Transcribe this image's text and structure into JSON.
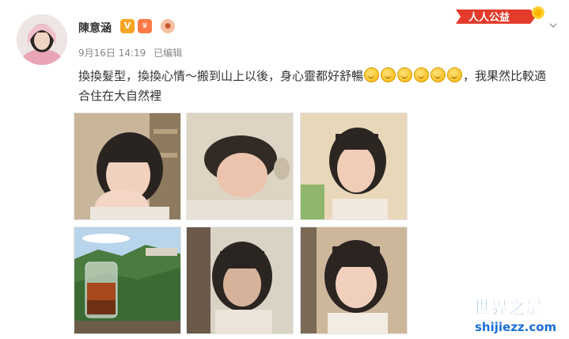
{
  "user": {
    "name": "陳意涵",
    "badges": [
      "verified-v-icon",
      "vip-crown-icon",
      "pig-icon"
    ]
  },
  "meta": {
    "date": "9月16日 14:19",
    "edited": "已编辑"
  },
  "renren": {
    "label": "人人公益"
  },
  "post": {
    "text_part1": "換換髮型，換換心情～搬到山上以後，身心靈都好舒暢",
    "emoji_count": 6,
    "text_part2": "，我果然比較適合住在大自然裡"
  },
  "photos": [
    {
      "name": "photo-hand-on-chin",
      "kind": "portrait"
    },
    {
      "name": "photo-lying-down",
      "kind": "portrait"
    },
    {
      "name": "photo-bob-side",
      "kind": "portrait"
    },
    {
      "name": "photo-mountain-tea",
      "kind": "landscape"
    },
    {
      "name": "photo-dark-room",
      "kind": "portrait"
    },
    {
      "name": "photo-smile-bangs",
      "kind": "portrait"
    }
  ],
  "watermark": {
    "title": "世界之最",
    "url": "shijiezz.com"
  },
  "colors": {
    "name": "#333333",
    "meta": "#888888",
    "renren_red": "#e43b2b",
    "watermark_blue": "#1b6fd1"
  }
}
